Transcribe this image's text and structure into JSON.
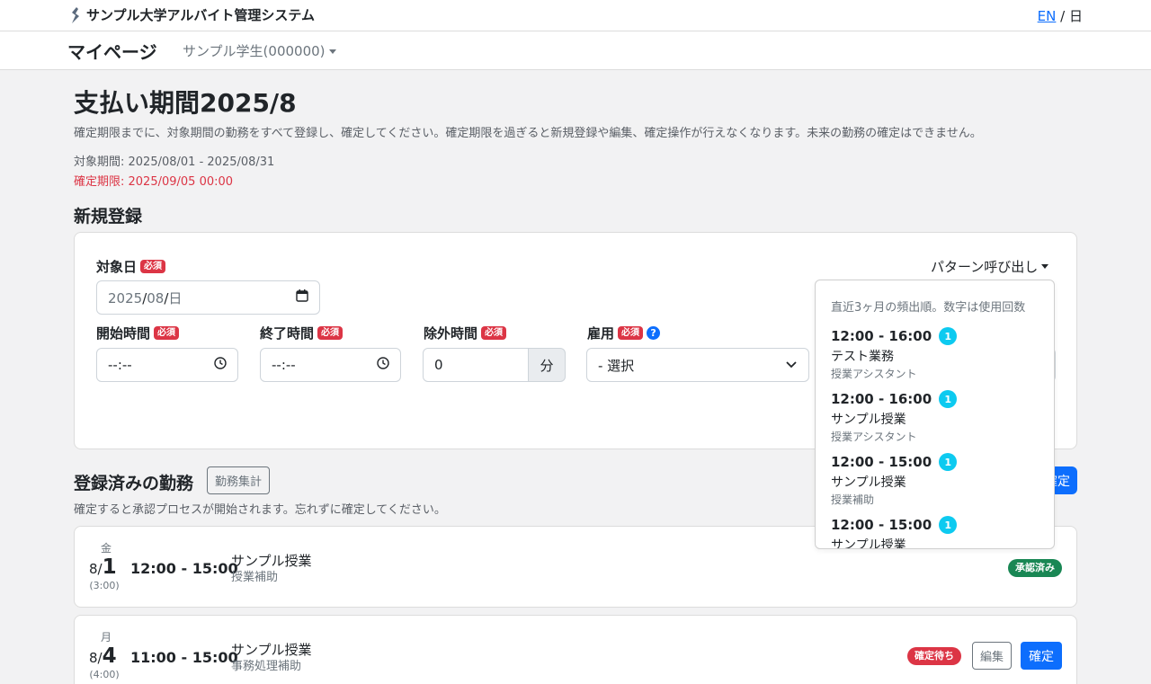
{
  "header": {
    "app_title": "サンプル大学アルバイト管理システム",
    "lang_en": "EN",
    "lang_sep": "/",
    "lang_ja": "日"
  },
  "nav": {
    "title": "マイページ",
    "user": "サンプル学生(000000)"
  },
  "page": {
    "title": "支払い期間2025/8",
    "description": "確定期限までに、対象期間の勤務をすべて登録し、確定してください。確定期限を過ぎると新規登録や編集、確定操作が行えなくなります。未来の勤務の確定はできません。",
    "target_period": "対象期間: 2025/08/01 - 2025/08/31",
    "deadline": "確定期限: 2025/09/05 00:00"
  },
  "new_entry": {
    "heading": "新規登録",
    "required_badge": "必須",
    "date": {
      "label": "対象日",
      "year": "2025",
      "sep1": "/",
      "month": "08",
      "sep2": "/",
      "day": "日"
    },
    "start": {
      "label": "開始時間",
      "value": "--:--"
    },
    "end": {
      "label": "終了時間",
      "value": "--:--"
    },
    "exclude": {
      "label": "除外時間",
      "value": "0",
      "unit": "分"
    },
    "employment": {
      "label": "雇用",
      "help": "?",
      "value": "- 選択"
    },
    "pattern_button": "パターン呼び出し"
  },
  "pattern_dropdown": {
    "header": "直近3ヶ月の頻出順。数字は使用回数",
    "items": [
      {
        "time": "12:00 - 16:00",
        "count": "1",
        "job": "テスト業務",
        "role": "授業アシスタント"
      },
      {
        "time": "12:00 - 16:00",
        "count": "1",
        "job": "サンプル授業",
        "role": "授業アシスタント"
      },
      {
        "time": "12:00 - 15:00",
        "count": "1",
        "job": "サンプル授業",
        "role": "授業補助"
      },
      {
        "time": "12:00 - 15:00",
        "count": "1",
        "job": "サンプル授業",
        "role": ""
      }
    ]
  },
  "registered": {
    "heading": "登録済みの勤務",
    "summary_button": "勤務集計",
    "confirm_all_button": "確定",
    "note": "確定すると承認プロセスが開始されます。忘れずに確定してください。",
    "edit_label": "編集",
    "confirm_label": "確定",
    "rows": [
      {
        "weekday": "金",
        "month": "8/",
        "day": "1",
        "duration": "(3:00)",
        "time": "12:00 - 15:00",
        "job": "サンプル授業",
        "role": "授業補助",
        "status": "承認済み"
      },
      {
        "weekday": "月",
        "month": "8/",
        "day": "4",
        "duration": "(4:00)",
        "time": "11:00 - 15:00",
        "job": "サンプル授業",
        "role": "事務処理補助",
        "status": "確定待ち"
      }
    ]
  },
  "colors": {
    "primary": "#0d6efd",
    "danger": "#dc3545",
    "success": "#198754",
    "info": "#0dcaf0",
    "background": "#f2f2f3"
  }
}
